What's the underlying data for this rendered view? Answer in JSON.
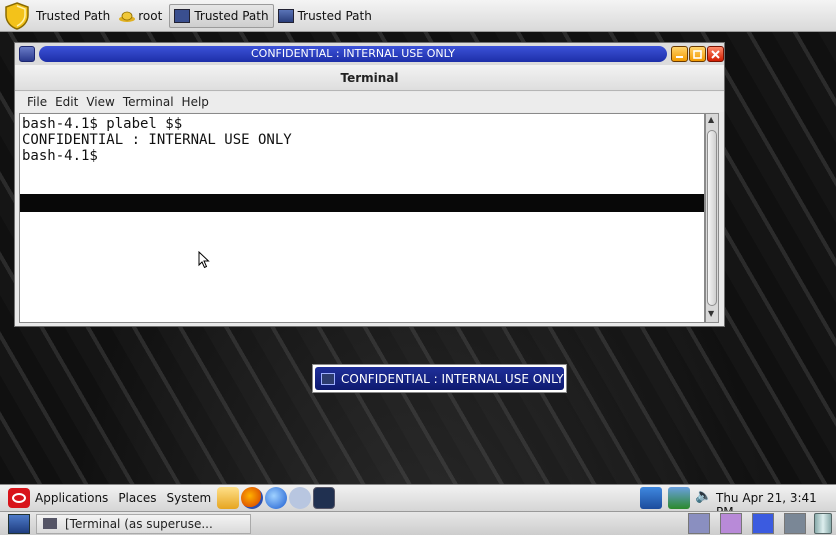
{
  "top_bar": {
    "trusted_path_1": "Trusted Path",
    "role_label": "root",
    "trusted_path_2": "Trusted Path",
    "trusted_path_3": "Trusted Path"
  },
  "window": {
    "label_title": "CONFIDENTIAL : INTERNAL USE ONLY",
    "app_title": "Terminal",
    "menu": [
      "File",
      "Edit",
      "View",
      "Terminal",
      "Help"
    ],
    "terminal_lines": [
      "bash-4.1$ plabel $$",
      "CONFIDENTIAL : INTERNAL USE ONLY",
      "bash-4.1$"
    ]
  },
  "label_popup": {
    "text": "CONFIDENTIAL : INTERNAL USE ONLY"
  },
  "bottom_panel": {
    "menus": [
      "Applications",
      "Places",
      "System"
    ],
    "clock": "Thu Apr 21,  3:41 PM",
    "taskbar_item": "[Terminal (as superuse..."
  },
  "colors": {
    "label_blue": "#1d2fa8",
    "workspace_colors": [
      "#8a8fc0",
      "#b88ad8",
      "#3b5be0",
      "#7a8796"
    ]
  }
}
